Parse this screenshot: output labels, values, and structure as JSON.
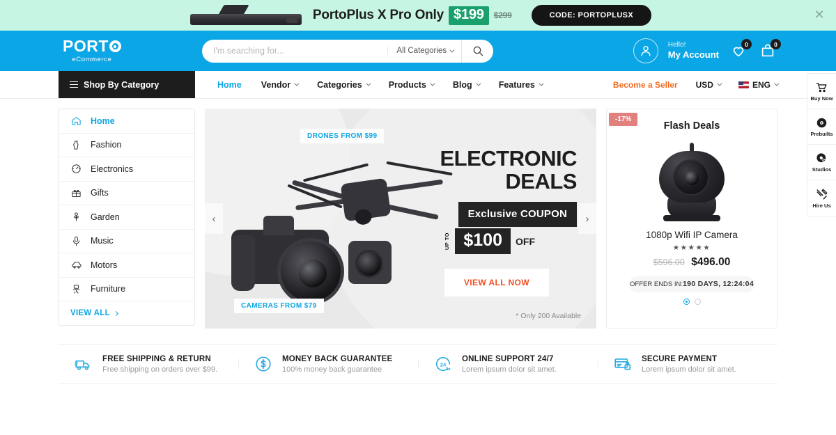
{
  "promo": {
    "text_before": "PortoPlus X Pro Only",
    "price": "$199",
    "old_price": "$299",
    "code_label": "CODE:",
    "code_value": "PORTOPLUSX",
    "close_icon": "close-icon",
    "bg_color": "#c7f5e3",
    "price_bg": "#19a06d"
  },
  "header": {
    "logo_main": "PORT",
    "logo_sub": "eCommerce",
    "accent_color": "#0aa6e5",
    "search": {
      "placeholder": "I'm searching for...",
      "value": "",
      "category": "All Categories",
      "search_icon": "search-icon"
    },
    "account": {
      "hello": "Hello!",
      "name": "My Account",
      "avatar_icon": "user-icon",
      "wishlist_icon": "heart-icon",
      "wishlist_count": "0",
      "cart_icon": "cart-bag-icon",
      "cart_count": "0"
    }
  },
  "nav": {
    "shop_by_category": "Shop By Category",
    "items": [
      {
        "label": "Home",
        "active": true,
        "caret": false
      },
      {
        "label": "Vendor",
        "active": false,
        "caret": true
      },
      {
        "label": "Categories",
        "active": false,
        "caret": true
      },
      {
        "label": "Products",
        "active": false,
        "caret": true
      },
      {
        "label": "Blog",
        "active": false,
        "caret": true
      },
      {
        "label": "Features",
        "active": false,
        "caret": true
      }
    ],
    "become_seller": "Become a Seller",
    "seller_color": "#f26b21",
    "currency": "USD",
    "language": "ENG"
  },
  "sidebar": {
    "items": [
      {
        "label": "Home",
        "icon": "home-icon"
      },
      {
        "label": "Fashion",
        "icon": "dress-icon"
      },
      {
        "label": "Electronics",
        "icon": "gauge-icon"
      },
      {
        "label": "Gifts",
        "icon": "gift-icon"
      },
      {
        "label": "Garden",
        "icon": "flower-icon"
      },
      {
        "label": "Music",
        "icon": "microphone-icon"
      },
      {
        "label": "Motors",
        "icon": "car-icon"
      },
      {
        "label": "Furniture",
        "icon": "chair-icon"
      }
    ],
    "view_all": "VIEW ALL"
  },
  "hero": {
    "tag_drones": "DRONES FROM $99",
    "tag_cameras": "CAMERAS FROM $79",
    "title_line1": "ELECTRONIC",
    "title_line2": "DEALS",
    "coupon_light": "Exclusive",
    "coupon_bold": "COUPON",
    "up_to": "UP TO",
    "amount": "$100",
    "off": "OFF",
    "cta": "VIEW ALL NOW",
    "cta_color": "#f04e23",
    "availability": "* Only 200 Available",
    "prev_icon": "chevron-left-icon",
    "next_icon": "chevron-right-icon"
  },
  "flash": {
    "discount": "-17%",
    "title": "Flash Deals",
    "product_name": "1080p Wifi IP Camera",
    "stars": "★★★★★",
    "old_price": "$596.00",
    "new_price": "$496.00",
    "timer_label": "OFFER ENDS IN:",
    "timer_value": "190 DAYS, 12:24:04",
    "badge_color": "#e2807e"
  },
  "features": [
    {
      "icon": "truck-icon",
      "title": "FREE SHIPPING & RETURN",
      "subtitle": "Free shipping on orders over $99."
    },
    {
      "icon": "dollar-circle-icon",
      "title": "MONEY BACK GUARANTEE",
      "subtitle": "100% money back guarantee"
    },
    {
      "icon": "support-24-icon",
      "title": "ONLINE SUPPORT 24/7",
      "subtitle": "Lorem ipsum dolor sit amet."
    },
    {
      "icon": "card-lock-icon",
      "title": "SECURE PAYMENT",
      "subtitle": "Lorem ipsum dolor sit amet."
    }
  ],
  "right_float": [
    {
      "label": "Buy Now",
      "icon": "cart-icon"
    },
    {
      "label": "Prebuilts",
      "icon": "disc-icon"
    },
    {
      "label": "Studios",
      "icon": "cursor-target-icon"
    },
    {
      "label": "Hire Us",
      "icon": "tools-icon"
    }
  ]
}
